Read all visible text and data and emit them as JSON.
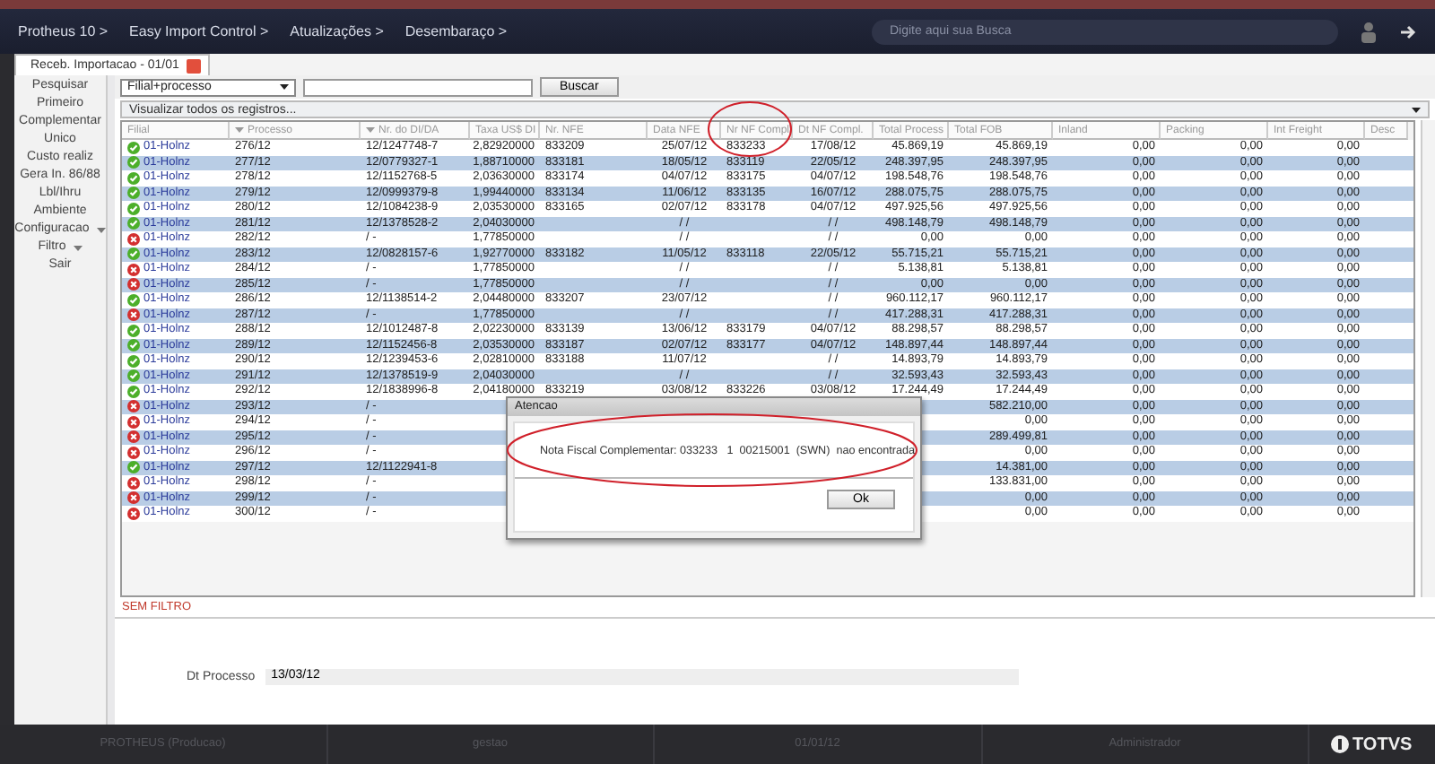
{
  "nav": {
    "breadcrumbs": [
      "Protheus 10 >",
      "Easy Import Control >",
      "Atualizações >",
      "Desembaraço >"
    ],
    "search": {
      "placeholder": "Digite aqui sua Busca"
    }
  },
  "tab": {
    "label": "Receb. Importacao - 01/01",
    "selected": true
  },
  "sidebar": {
    "items": [
      {
        "label": "Pesquisar",
        "kind": "plain"
      },
      {
        "label": "Primeiro",
        "kind": "plain"
      },
      {
        "label": "Complementar",
        "kind": "plain"
      },
      {
        "label": "Unico",
        "kind": "plain"
      },
      {
        "label": "Custo realiz",
        "kind": "plain"
      },
      {
        "label": "Gera In. 86/88",
        "kind": "plain"
      },
      {
        "label": "Lbl/Ihru",
        "kind": "plain"
      },
      {
        "label": "Ambiente",
        "kind": "plain"
      },
      {
        "label": "Configuracao",
        "kind": "menu"
      },
      {
        "label": "Filtro",
        "kind": "menu"
      },
      {
        "label": "Sair",
        "kind": "plain"
      }
    ]
  },
  "toolbar": {
    "index_select": "Filial+processo",
    "search_button": "Buscar",
    "view_select": "Visualizar todos os registros..."
  },
  "table": {
    "columns": [
      "Filial",
      "Processo",
      "Nr. do DI/DA",
      "Taxa US$ DI",
      "Nr. NFE",
      "Data NFE",
      "Nr NF Compl",
      "Dt NF Compl.",
      "Total Process",
      "Total FOB",
      "Inland",
      "Packing",
      "Int Freight",
      "Desc"
    ],
    "sorted_columns": [
      false,
      true,
      true,
      false,
      false,
      false,
      false,
      false,
      false,
      false,
      false,
      false,
      false,
      false
    ],
    "rows": [
      {
        "kind": "ok",
        "cells": [
          "01-Holnz",
          "276/12",
          "12/1247748-7",
          "2,82920000",
          "833209",
          "25/07/12",
          "833233",
          "17/08/12",
          "45.869,19",
          "45.869,19",
          "0,00",
          "0,00",
          "0,00"
        ]
      },
      {
        "kind": "ok",
        "cells": [
          "01-Holnz",
          "277/12",
          "12/0779327-1",
          "1,88710000",
          "833181",
          "18/05/12",
          "833119",
          "22/05/12",
          "248.397,95",
          "248.397,95",
          "0,00",
          "0,00",
          "0,00"
        ]
      },
      {
        "kind": "ok",
        "cells": [
          "01-Holnz",
          "278/12",
          "12/1152768-5",
          "2,03630000",
          "833174",
          "04/07/12",
          "833175",
          "04/07/12",
          "198.548,76",
          "198.548,76",
          "0,00",
          "0,00",
          "0,00"
        ]
      },
      {
        "kind": "ok",
        "cells": [
          "01-Holnz",
          "279/12",
          "12/0999379-8",
          "1,99440000",
          "833134",
          "11/06/12",
          "833135",
          "16/07/12",
          "288.075,75",
          "288.075,75",
          "0,00",
          "0,00",
          "0,00"
        ]
      },
      {
        "kind": "ok",
        "cells": [
          "01-Holnz",
          "280/12",
          "12/1084238-9",
          "2,03530000",
          "833165",
          "02/07/12",
          "833178",
          "04/07/12",
          "497.925,56",
          "497.925,56",
          "0,00",
          "0,00",
          "0,00"
        ]
      },
      {
        "kind": "ok",
        "cells": [
          "01-Holnz",
          "281/12",
          "12/1378528-2",
          "2,04030000",
          "",
          "/ /",
          "",
          "/ /",
          "498.148,79",
          "498.148,79",
          "0,00",
          "0,00",
          "0,00"
        ]
      },
      {
        "kind": "error",
        "cells": [
          "01-Holnz",
          "282/12",
          "/   -",
          "1,77850000",
          "",
          "/ /",
          "",
          "/ /",
          "0,00",
          "0,00",
          "0,00",
          "0,00",
          "0,00"
        ]
      },
      {
        "kind": "ok",
        "cells": [
          "01-Holnz",
          "283/12",
          "12/0828157-6",
          "1,92770000",
          "833182",
          "11/05/12",
          "833118",
          "22/05/12",
          "55.715,21",
          "55.715,21",
          "0,00",
          "0,00",
          "0,00"
        ]
      },
      {
        "kind": "error",
        "cells": [
          "01-Holnz",
          "284/12",
          "/   -",
          "1,77850000",
          "",
          "/ /",
          "",
          "/ /",
          "5.138,81",
          "5.138,81",
          "0,00",
          "0,00",
          "0,00"
        ]
      },
      {
        "kind": "error",
        "cells": [
          "01-Holnz",
          "285/12",
          "/   -",
          "1,77850000",
          "",
          "/ /",
          "",
          "/ /",
          "0,00",
          "0,00",
          "0,00",
          "0,00",
          "0,00"
        ]
      },
      {
        "kind": "ok",
        "cells": [
          "01-Holnz",
          "286/12",
          "12/1138514-2",
          "2,04480000",
          "833207",
          "23/07/12",
          "",
          "/ /",
          "960.112,17",
          "960.112,17",
          "0,00",
          "0,00",
          "0,00"
        ]
      },
      {
        "kind": "error",
        "cells": [
          "01-Holnz",
          "287/12",
          "/   -",
          "1,77850000",
          "",
          "/ /",
          "",
          "/ /",
          "417.288,31",
          "417.288,31",
          "0,00",
          "0,00",
          "0,00"
        ]
      },
      {
        "kind": "ok",
        "cells": [
          "01-Holnz",
          "288/12",
          "12/1012487-8",
          "2,02230000",
          "833139",
          "13/06/12",
          "833179",
          "04/07/12",
          "88.298,57",
          "88.298,57",
          "0,00",
          "0,00",
          "0,00"
        ]
      },
      {
        "kind": "ok",
        "cells": [
          "01-Holnz",
          "289/12",
          "12/1152456-8",
          "2,03530000",
          "833187",
          "02/07/12",
          "833177",
          "04/07/12",
          "148.897,44",
          "148.897,44",
          "0,00",
          "0,00",
          "0,00"
        ]
      },
      {
        "kind": "ok",
        "cells": [
          "01-Holnz",
          "290/12",
          "12/1239453-6",
          "2,02810000",
          "833188",
          "11/07/12",
          "",
          "/ /",
          "14.893,79",
          "14.893,79",
          "0,00",
          "0,00",
          "0,00"
        ]
      },
      {
        "kind": "ok",
        "cells": [
          "01-Holnz",
          "291/12",
          "12/1378519-9",
          "2,04030000",
          "",
          "/ /",
          "",
          "/ /",
          "32.593,43",
          "32.593,43",
          "0,00",
          "0,00",
          "0,00"
        ]
      },
      {
        "kind": "ok",
        "cells": [
          "01-Holnz",
          "292/12",
          "12/1838996-8",
          "2,04180000",
          "833219",
          "03/08/12",
          "833226",
          "03/08/12",
          "17.244,49",
          "17.244,49",
          "0,00",
          "0,00",
          "0,00"
        ]
      },
      {
        "kind": "error",
        "cells": [
          "01-Holnz",
          "293/12",
          "/   -",
          "",
          "",
          "",
          "",
          "",
          "",
          "582.210,00",
          "0,00",
          "0,00",
          "0,00"
        ]
      },
      {
        "kind": "error",
        "cells": [
          "01-Holnz",
          "294/12",
          "/   -",
          "",
          "",
          "",
          "",
          "",
          "",
          "0,00",
          "0,00",
          "0,00",
          "0,00"
        ]
      },
      {
        "kind": "error",
        "cells": [
          "01-Holnz",
          "295/12",
          "/   -",
          "",
          "",
          "",
          "",
          "",
          "",
          "289.499,81",
          "0,00",
          "0,00",
          "0,00"
        ]
      },
      {
        "kind": "error",
        "cells": [
          "01-Holnz",
          "296/12",
          "/   -",
          "",
          "",
          "",
          "",
          "",
          "",
          "0,00",
          "0,00",
          "0,00",
          "0,00"
        ]
      },
      {
        "kind": "ok",
        "cells": [
          "01-Holnz",
          "297/12",
          "12/1122941-8",
          "",
          "",
          "",
          "",
          "",
          "",
          "14.381,00",
          "0,00",
          "0,00",
          "0,00"
        ]
      },
      {
        "kind": "error",
        "cells": [
          "01-Holnz",
          "298/12",
          "/   -",
          "",
          "",
          "",
          "",
          "",
          "",
          "133.831,00",
          "0,00",
          "0,00",
          "0,00"
        ]
      },
      {
        "kind": "error",
        "cells": [
          "01-Holnz",
          "299/12",
          "/   -",
          "",
          "",
          "",
          "",
          "",
          "",
          "0,00",
          "0,00",
          "0,00",
          "0,00"
        ]
      },
      {
        "kind": "error",
        "cells": [
          "01-Holnz",
          "300/12",
          "/   -",
          "",
          "",
          "",
          "",
          "",
          "",
          "0,00",
          "0,00",
          "0,00",
          "0,00"
        ]
      }
    ]
  },
  "filter_status": "SEM FILTRO",
  "detail": {
    "label": "Dt Processo",
    "value": "13/03/12"
  },
  "dialog": {
    "title": "Atencao",
    "message": "Nota Fiscal Complementar: 033233   1  00215001  (SWN)  nao encontrada",
    "button": "Ok"
  },
  "footer": {
    "items": [
      "PROTHEUS (Producao)",
      "gestao",
      "01/01/12",
      "Administrador"
    ],
    "logo": "TOTVS"
  }
}
